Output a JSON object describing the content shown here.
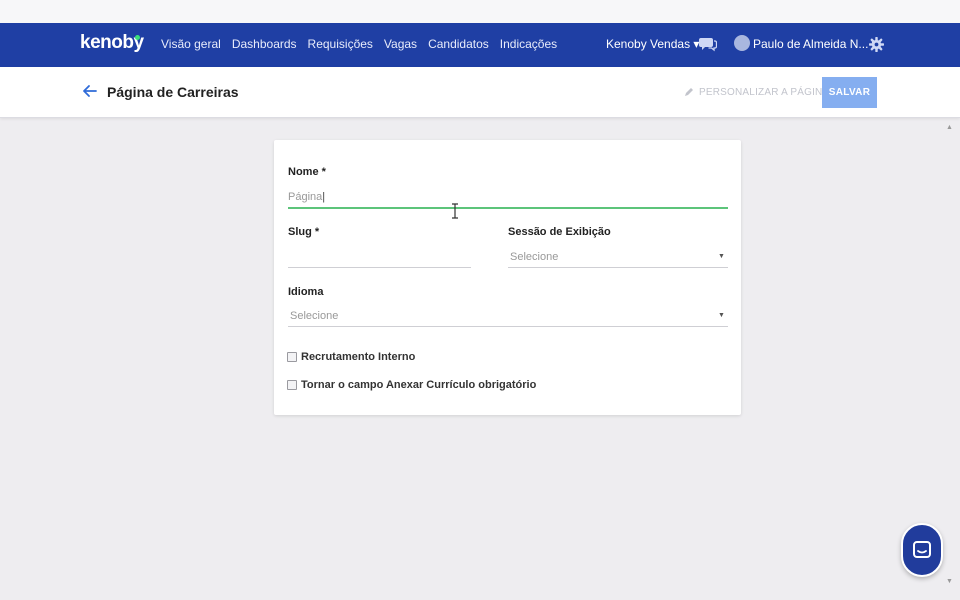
{
  "nav": {
    "logo": "kenoby",
    "links": [
      "Visão geral",
      "Dashboards",
      "Requisições",
      "Vagas",
      "Candidatos",
      "Indicações"
    ],
    "company": "Kenoby Vendas ▾",
    "user": "Paulo de Almeida N... ▾"
  },
  "header": {
    "title": "Página de Carreiras",
    "customize": "PERSONALIZAR A PÁGINA",
    "save": "SALVAR"
  },
  "form": {
    "nome_label": "Nome *",
    "nome_value": "Página",
    "slug_label": "Slug *",
    "sessao_label": "Sessão de Exibição",
    "sessao_value": "Selecione",
    "idioma_label": "Idioma",
    "idioma_value": "Selecione",
    "checkbox_interno": "Recrutamento Interno",
    "checkbox_anexar": "Tornar o campo Anexar Currículo obrigatório"
  },
  "colors": {
    "navbar": "#1f3fa4",
    "accent_green": "#5cc47a",
    "save_button": "#85aef0"
  }
}
